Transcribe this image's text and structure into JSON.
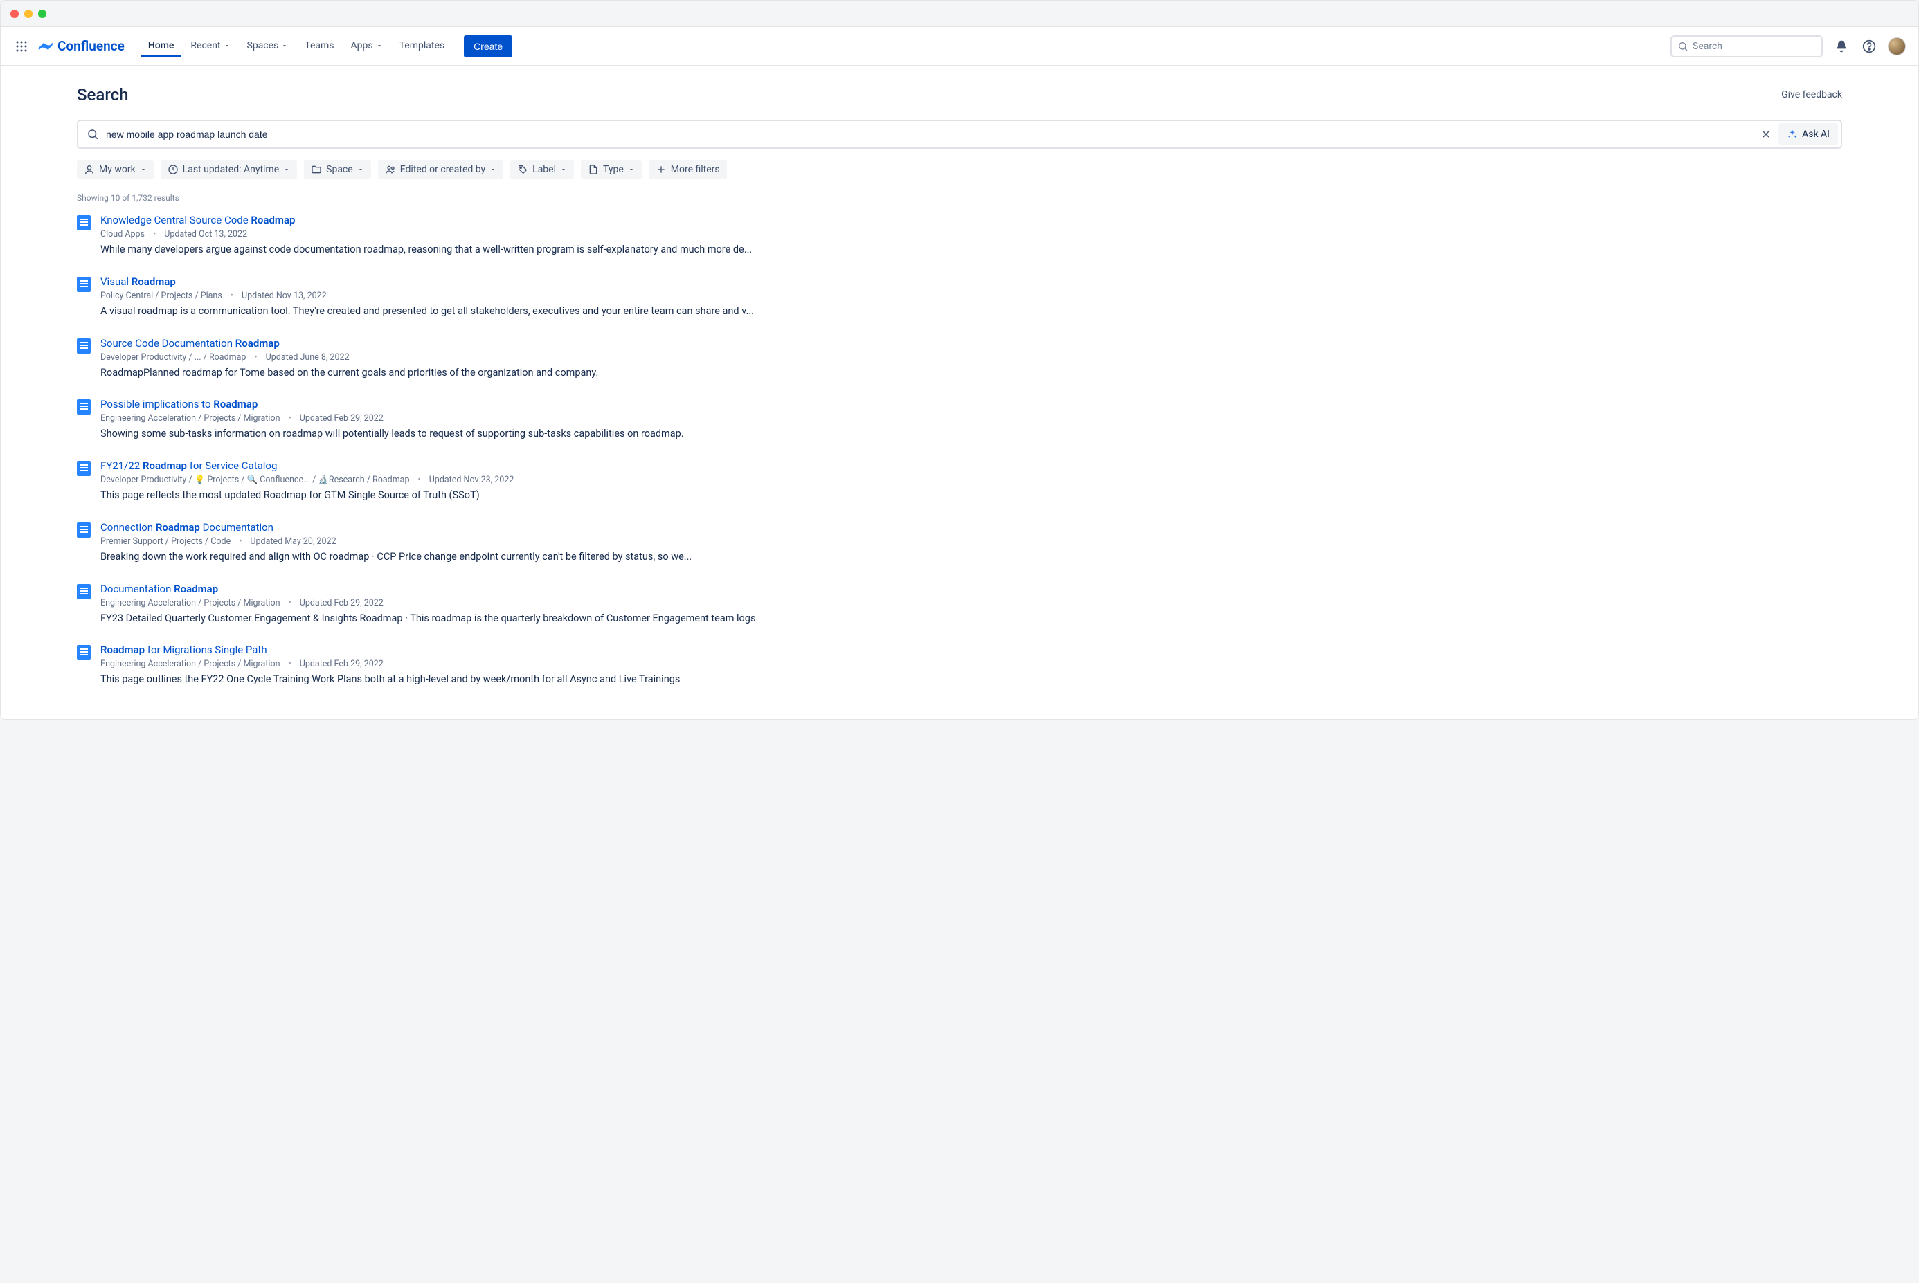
{
  "brand": "Confluence",
  "nav": {
    "items": [
      {
        "label": "Home",
        "dropdown": false,
        "active": true
      },
      {
        "label": "Recent",
        "dropdown": true
      },
      {
        "label": "Spaces",
        "dropdown": true
      },
      {
        "label": "Teams",
        "dropdown": false
      },
      {
        "label": "Apps",
        "dropdown": true
      },
      {
        "label": "Templates",
        "dropdown": false
      }
    ],
    "create": "Create",
    "search_placeholder": "Search"
  },
  "page": {
    "title": "Search",
    "feedback": "Give feedback",
    "query": "new mobile app roadmap launch date",
    "ask_ai": "Ask AI"
  },
  "filters": [
    {
      "icon": "person",
      "label": "My work",
      "chev": true
    },
    {
      "icon": "clock",
      "label": "Last updated: Anytime",
      "chev": true
    },
    {
      "icon": "folder",
      "label": "Space",
      "chev": true
    },
    {
      "icon": "people",
      "label": "Edited or created by",
      "chev": true
    },
    {
      "icon": "tag",
      "label": "Label",
      "chev": true
    },
    {
      "icon": "file",
      "label": "Type",
      "chev": true
    },
    {
      "icon": "plus",
      "label": "More filters",
      "chev": false
    }
  ],
  "results_count": "Showing 10 of 1,732 results",
  "results": [
    {
      "title_pre": "Knowledge Central Source Code ",
      "title_hl": "Roadmap",
      "title_post": "",
      "meta_path": "Cloud Apps",
      "meta_updated": "Updated Oct 13, 2022",
      "snippet": "While many developers argue against code documentation roadmap, reasoning that a well-written program is self-explanatory and much more de..."
    },
    {
      "title_pre": "Visual ",
      "title_hl": "Roadmap",
      "title_post": "",
      "meta_path": "Policy Central / Projects / Plans",
      "meta_updated": "Updated Nov 13, 2022",
      "snippet": "A visual roadmap is a communication tool. They're created and presented to get all stakeholders, executives and your entire team can share and v..."
    },
    {
      "title_pre": "Source Code Documentation ",
      "title_hl": "Roadmap",
      "title_post": "",
      "meta_path": "Developer Productivity / ... / Roadmap",
      "meta_updated": "Updated June 8, 2022",
      "snippet": "RoadmapPlanned roadmap for Tome based on the current goals and priorities of the organization and company."
    },
    {
      "title_pre": "Possible implications to ",
      "title_hl": "Roadmap",
      "title_post": "",
      "meta_path": "Engineering Acceleration / Projects / Migration",
      "meta_updated": "Updated Feb 29, 2022",
      "snippet": "Showing some sub-tasks information on roadmap will potentially leads to request of supporting sub-tasks capabilities on roadmap."
    },
    {
      "title_pre": "FY21/22 ",
      "title_hl": "Roadmap",
      "title_post": " for Service Catalog",
      "meta_path": "Developer Productivity / 💡 Projects / 🔍 Confluence... / 🔬Research / Roadmap",
      "meta_updated": "Updated Nov 23, 2022",
      "snippet": "This page reflects the most updated Roadmap for GTM Single Source of Truth (SSoT)"
    },
    {
      "title_pre": "Connection ",
      "title_hl": "Roadmap",
      "title_post": " Documentation",
      "meta_path": "Premier Support / Projects / Code",
      "meta_updated": "Updated May 20, 2022",
      "snippet": "Breaking down the work required and align with OC roadmap · CCP Price change endpoint currently can't be filtered by status, so we..."
    },
    {
      "title_pre": "Documentation ",
      "title_hl": "Roadmap",
      "title_post": "",
      "meta_path": "Engineering Acceleration / Projects / Migration",
      "meta_updated": "Updated Feb 29, 2022",
      "snippet": "FY23 Detailed Quarterly Customer Engagement & Insights Roadmap · This roadmap is the quarterly breakdown of Customer Engagement team logs"
    },
    {
      "title_pre": "",
      "title_hl": "Roadmap",
      "title_post": " for Migrations Single Path",
      "meta_path": "Engineering Acceleration / Projects / Migration",
      "meta_updated": "Updated Feb 29, 2022",
      "snippet": "This page outlines the FY22 One Cycle Training Work Plans both at a high-level and by week/month for all Async and Live Trainings"
    }
  ]
}
